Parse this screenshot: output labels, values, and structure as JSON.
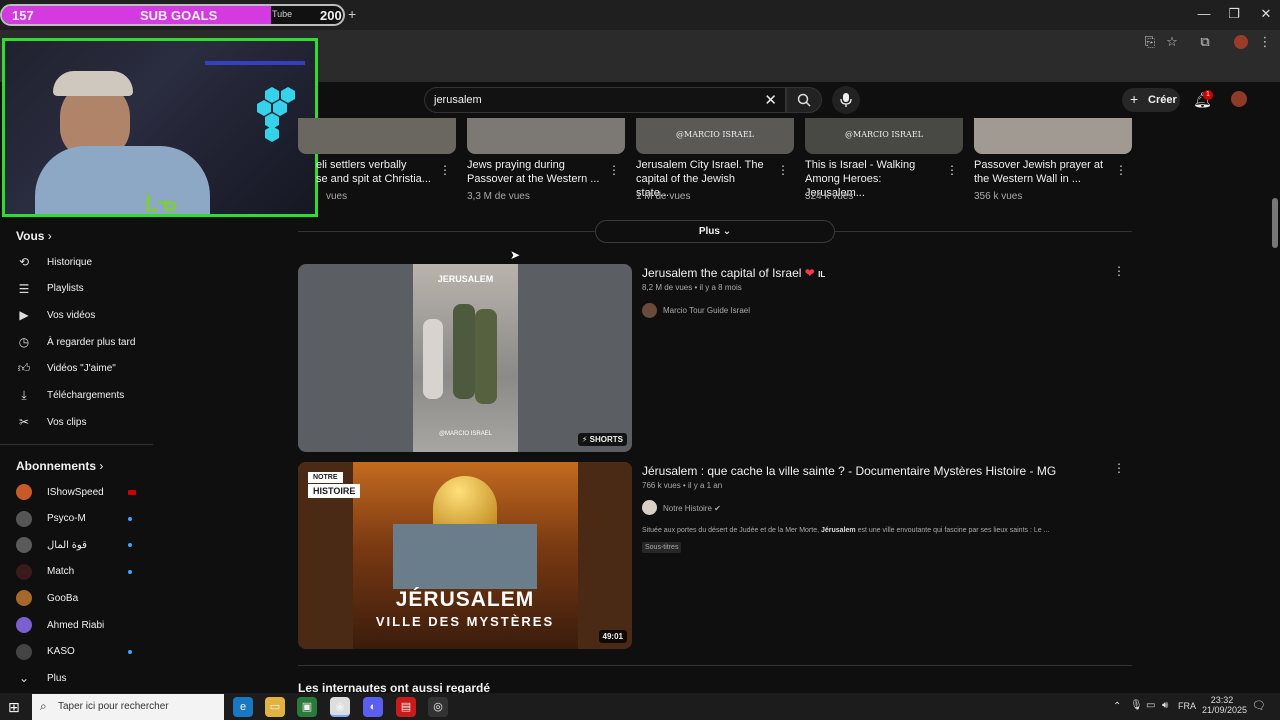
{
  "overlay": {
    "left_count": "157",
    "label": "SUB GOALS",
    "right_count": "200",
    "progress": 0.78
  },
  "browser": {
    "tab_fragment": "Tube",
    "new_tab": "+",
    "win_min": "—",
    "win_max": "❐",
    "win_close": "✕"
  },
  "youtube": {
    "search_value": "jerusalem",
    "create_label": "Créer",
    "notif_count": "1",
    "more_label": "Plus"
  },
  "sidebar": {
    "you_title": "Vous",
    "you_items": [
      {
        "label": "Historique",
        "icon": "history-icon"
      },
      {
        "label": "Playlists",
        "icon": "playlist-icon"
      },
      {
        "label": "Vos vidéos",
        "icon": "play-icon"
      },
      {
        "label": "À regarder plus tard",
        "icon": "clock-icon"
      },
      {
        "label": "Vidéos \"J'aime\"",
        "icon": "thumbs-up-icon"
      },
      {
        "label": "Téléchargements",
        "icon": "download-icon"
      },
      {
        "label": "Vos clips",
        "icon": "scissors-icon"
      }
    ],
    "subs_title": "Abonnements",
    "subscriptions": [
      {
        "name": "IShowSpeed",
        "color": "#c85a2a"
      },
      {
        "name": "Psyco-M",
        "color": "#555555"
      },
      {
        "name": "قوة المال",
        "color": "#5a5a5a"
      },
      {
        "name": "Match",
        "color": "#3a1a1a"
      },
      {
        "name": "GooBa",
        "color": "#a5682a"
      },
      {
        "name": "Ahmed Riabi",
        "color": "#7b5fd1"
      },
      {
        "name": "KASO",
        "color": "#444444"
      }
    ],
    "more_label": "Plus"
  },
  "top_row": [
    {
      "title1": "eli settlers verbally",
      "title2": "se and spit at Christia...",
      "meta": "vues",
      "watermark": ""
    },
    {
      "title1": "Jews praying during",
      "title2": "Passover at the Western ...",
      "meta": "3,3 M de vues",
      "watermark": ""
    },
    {
      "title1": "Jerusalem City Israel. The",
      "title2": "capital of the Jewish state...",
      "meta": "1 M de vues",
      "watermark": "@MARCIO ISRAEL"
    },
    {
      "title1": "This is Israel - Walking",
      "title2": "Among Heroes: Jerusalem...",
      "meta": "324 k vues",
      "watermark": "@MARCIO ISRAEL"
    },
    {
      "title1": "Passover Jewish prayer at",
      "title2": "the Western Wall in ...",
      "meta": "356 k vues",
      "watermark": ""
    }
  ],
  "results": [
    {
      "title": "Jerusalem the capital of Israel",
      "flag": "IL",
      "meta": "8,2 M de vues • il y a 8 mois",
      "channel": "Marcio Tour Guide Israel",
      "badge": "SHORTS",
      "thumb_top": "JERUSALEM",
      "thumb_bottom": "@MARCIO ISRAEL"
    },
    {
      "title": "Jérusalem : que cache la ville sainte ? - Documentaire Mystères Histoire - MG",
      "meta": "766 k vues • il y a 1 an",
      "channel": "Notre Histoire",
      "desc_before": "Située aux portes du désert de Judée et de la Mer Morte, ",
      "desc_bold": "Jérusalem",
      "desc_after": " est une ville envoutante qui fascine par ses lieux saints : Le ...",
      "tag": "Sous-titres",
      "duration": "49:01",
      "badge1": "NOTRE",
      "badge2": "HISTOIRE",
      "thumb_title": "JÉRUSALEM",
      "thumb_subtitle": "VILLE DES MYSTÈRES"
    }
  ],
  "section_title": "Les internautes ont aussi regardé",
  "taskbar": {
    "search_placeholder": "Taper ici pour rechercher",
    "lang": "FRA",
    "time": "23:32",
    "date": "21/09/2025"
  }
}
